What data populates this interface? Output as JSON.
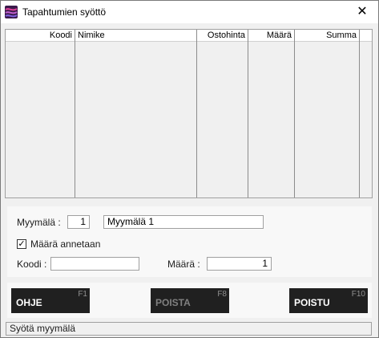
{
  "window": {
    "title": "Tapahtumien syöttö",
    "close_glyph": "✕"
  },
  "grid": {
    "columns": [
      "Koodi",
      "Nimike",
      "Ostohinta",
      "Määrä",
      "Summa"
    ]
  },
  "form": {
    "store_label": "Myymälä :",
    "store_code": "1",
    "store_name": "Myymälä 1",
    "quantity_checkbox_label": "Määrä annetaan",
    "quantity_checkbox_checked": true,
    "code_label": "Koodi :",
    "code_value": "",
    "quantity_label": "Määrä :",
    "quantity_value": "1"
  },
  "buttons": [
    {
      "label": "OHJE",
      "key": "F1",
      "enabled": true
    },
    {
      "label": "POISTA",
      "key": "F8",
      "enabled": false
    },
    {
      "label": "POISTU",
      "key": "F10",
      "enabled": true
    }
  ],
  "status": {
    "text": "Syötä myymälä"
  },
  "icons": {
    "app": "app-logo-icon",
    "close": "close-icon",
    "check": "checkmark-icon"
  }
}
